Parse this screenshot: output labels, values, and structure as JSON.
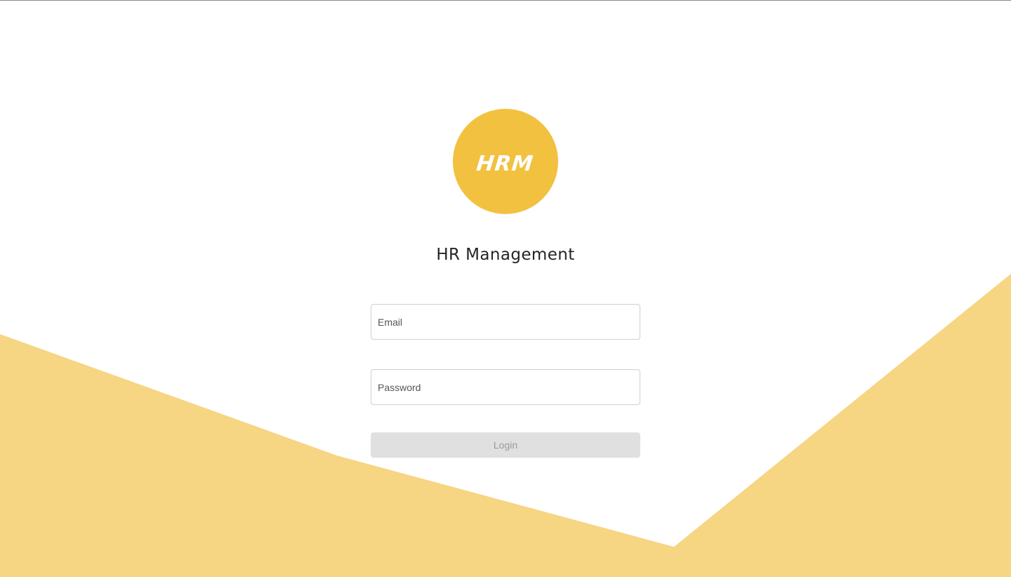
{
  "app": {
    "logo_text": "HRM",
    "title": "HR Management"
  },
  "form": {
    "email_placeholder": "Email",
    "email_value": "",
    "password_placeholder": "Password",
    "password_value": "",
    "login_label": "Login",
    "login_enabled": false
  },
  "colors": {
    "logo_circle": "#F2C140",
    "background_shape": "#F6D583",
    "button_disabled_bg": "#E0E0E0",
    "button_disabled_text": "#9A9A9A",
    "title_text": "#222428"
  }
}
